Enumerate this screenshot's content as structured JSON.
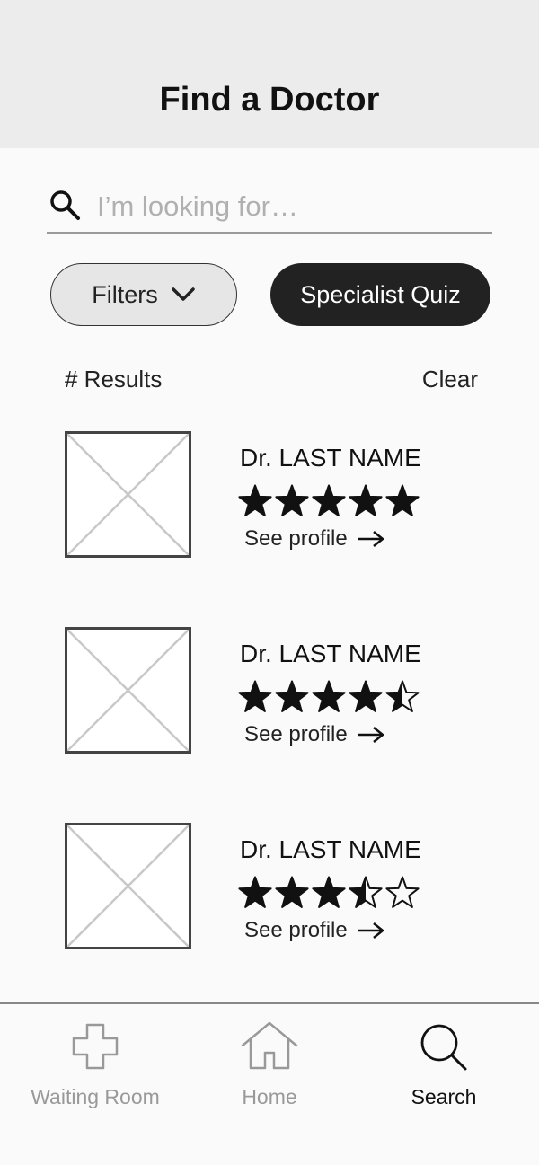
{
  "header": {
    "title": "Find a Doctor"
  },
  "search": {
    "placeholder": "I’m looking for…",
    "value": ""
  },
  "buttons": {
    "filters_label": "Filters",
    "quiz_label": "Specialist Quiz"
  },
  "results": {
    "count_label": "# Results",
    "clear_label": "Clear"
  },
  "doctors": [
    {
      "name": "Dr. LAST NAME",
      "rating": 5,
      "link_label": "See profile"
    },
    {
      "name": "Dr. LAST NAME",
      "rating": 4.5,
      "link_label": "See profile"
    },
    {
      "name": "Dr. LAST NAME",
      "rating": 3.5,
      "link_label": "See profile"
    }
  ],
  "tabbar": {
    "tabs": [
      {
        "label": "Waiting Room",
        "icon": "cross-icon",
        "active": false
      },
      {
        "label": "Home",
        "icon": "house-icon",
        "active": false
      },
      {
        "label": "Search",
        "icon": "search-icon",
        "active": true
      }
    ]
  },
  "colors": {
    "header_bg": "#ececec",
    "primary_button": "#222222",
    "inactive_tab": "#999999"
  }
}
